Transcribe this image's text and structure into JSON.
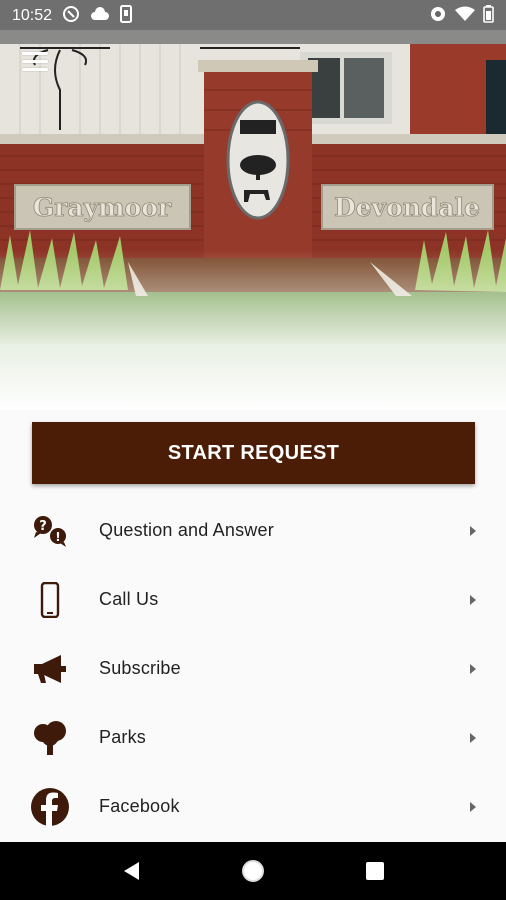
{
  "status": {
    "time": "10:52"
  },
  "hero": {
    "sign_left": "Graymoor",
    "sign_right": "Devondale"
  },
  "start_request_label": "START REQUEST",
  "menu": [
    {
      "label": "Question and Answer",
      "icon": "question-answer-icon"
    },
    {
      "label": "Call Us",
      "icon": "phone-icon"
    },
    {
      "label": "Subscribe",
      "icon": "megaphone-icon"
    },
    {
      "label": "Parks",
      "icon": "tree-icon"
    },
    {
      "label": "Facebook",
      "icon": "facebook-icon"
    }
  ],
  "colors": {
    "accent": "#4b1d06",
    "icon": "#3e1a0a"
  }
}
